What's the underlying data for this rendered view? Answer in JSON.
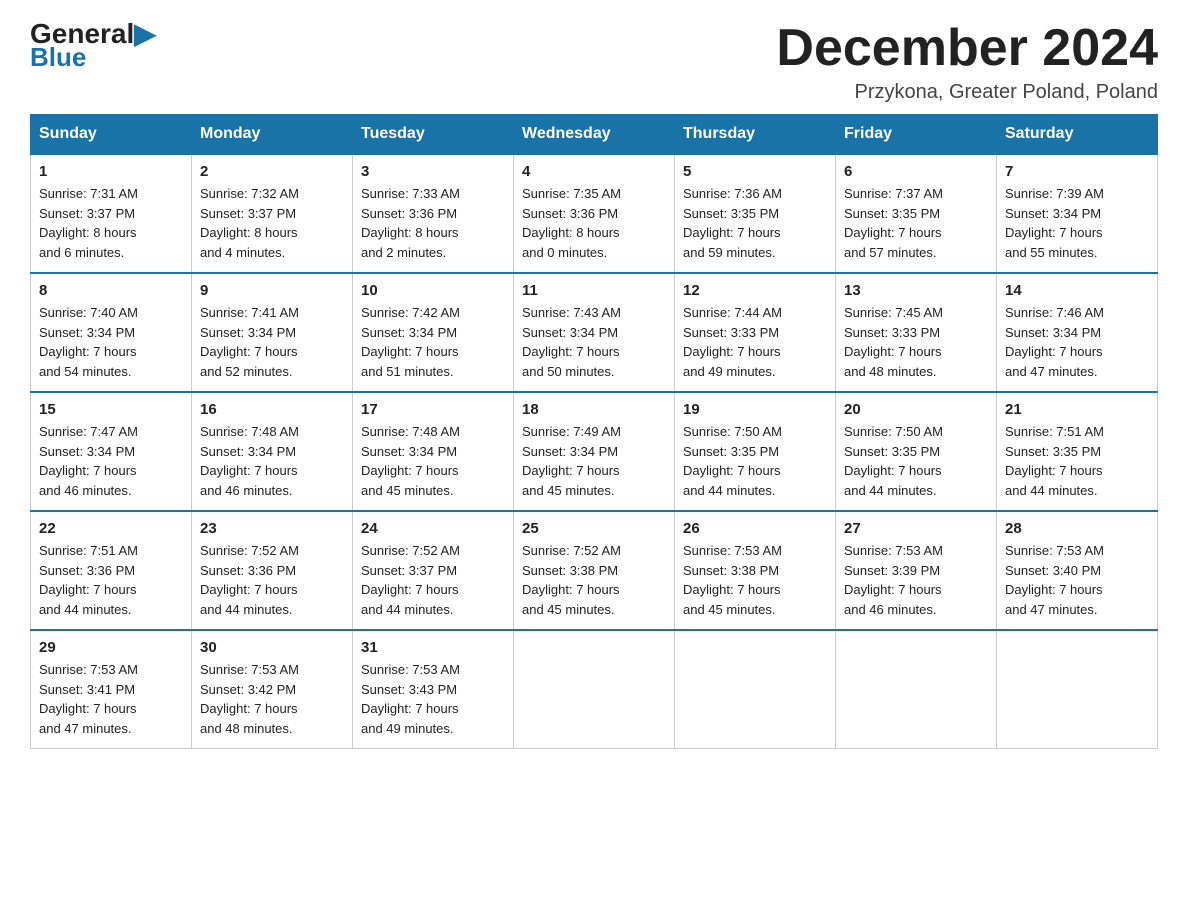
{
  "header": {
    "logo_general": "General",
    "logo_blue": "Blue",
    "title": "December 2024",
    "subtitle": "Przykona, Greater Poland, Poland"
  },
  "weekdays": [
    "Sunday",
    "Monday",
    "Tuesday",
    "Wednesday",
    "Thursday",
    "Friday",
    "Saturday"
  ],
  "weeks": [
    [
      {
        "day": "1",
        "sunrise": "7:31 AM",
        "sunset": "3:37 PM",
        "daylight": "8 hours and 6 minutes."
      },
      {
        "day": "2",
        "sunrise": "7:32 AM",
        "sunset": "3:37 PM",
        "daylight": "8 hours and 4 minutes."
      },
      {
        "day": "3",
        "sunrise": "7:33 AM",
        "sunset": "3:36 PM",
        "daylight": "8 hours and 2 minutes."
      },
      {
        "day": "4",
        "sunrise": "7:35 AM",
        "sunset": "3:36 PM",
        "daylight": "8 hours and 0 minutes."
      },
      {
        "day": "5",
        "sunrise": "7:36 AM",
        "sunset": "3:35 PM",
        "daylight": "7 hours and 59 minutes."
      },
      {
        "day": "6",
        "sunrise": "7:37 AM",
        "sunset": "3:35 PM",
        "daylight": "7 hours and 57 minutes."
      },
      {
        "day": "7",
        "sunrise": "7:39 AM",
        "sunset": "3:34 PM",
        "daylight": "7 hours and 55 minutes."
      }
    ],
    [
      {
        "day": "8",
        "sunrise": "7:40 AM",
        "sunset": "3:34 PM",
        "daylight": "7 hours and 54 minutes."
      },
      {
        "day": "9",
        "sunrise": "7:41 AM",
        "sunset": "3:34 PM",
        "daylight": "7 hours and 52 minutes."
      },
      {
        "day": "10",
        "sunrise": "7:42 AM",
        "sunset": "3:34 PM",
        "daylight": "7 hours and 51 minutes."
      },
      {
        "day": "11",
        "sunrise": "7:43 AM",
        "sunset": "3:34 PM",
        "daylight": "7 hours and 50 minutes."
      },
      {
        "day": "12",
        "sunrise": "7:44 AM",
        "sunset": "3:33 PM",
        "daylight": "7 hours and 49 minutes."
      },
      {
        "day": "13",
        "sunrise": "7:45 AM",
        "sunset": "3:33 PM",
        "daylight": "7 hours and 48 minutes."
      },
      {
        "day": "14",
        "sunrise": "7:46 AM",
        "sunset": "3:34 PM",
        "daylight": "7 hours and 47 minutes."
      }
    ],
    [
      {
        "day": "15",
        "sunrise": "7:47 AM",
        "sunset": "3:34 PM",
        "daylight": "7 hours and 46 minutes."
      },
      {
        "day": "16",
        "sunrise": "7:48 AM",
        "sunset": "3:34 PM",
        "daylight": "7 hours and 46 minutes."
      },
      {
        "day": "17",
        "sunrise": "7:48 AM",
        "sunset": "3:34 PM",
        "daylight": "7 hours and 45 minutes."
      },
      {
        "day": "18",
        "sunrise": "7:49 AM",
        "sunset": "3:34 PM",
        "daylight": "7 hours and 45 minutes."
      },
      {
        "day": "19",
        "sunrise": "7:50 AM",
        "sunset": "3:35 PM",
        "daylight": "7 hours and 44 minutes."
      },
      {
        "day": "20",
        "sunrise": "7:50 AM",
        "sunset": "3:35 PM",
        "daylight": "7 hours and 44 minutes."
      },
      {
        "day": "21",
        "sunrise": "7:51 AM",
        "sunset": "3:35 PM",
        "daylight": "7 hours and 44 minutes."
      }
    ],
    [
      {
        "day": "22",
        "sunrise": "7:51 AM",
        "sunset": "3:36 PM",
        "daylight": "7 hours and 44 minutes."
      },
      {
        "day": "23",
        "sunrise": "7:52 AM",
        "sunset": "3:36 PM",
        "daylight": "7 hours and 44 minutes."
      },
      {
        "day": "24",
        "sunrise": "7:52 AM",
        "sunset": "3:37 PM",
        "daylight": "7 hours and 44 minutes."
      },
      {
        "day": "25",
        "sunrise": "7:52 AM",
        "sunset": "3:38 PM",
        "daylight": "7 hours and 45 minutes."
      },
      {
        "day": "26",
        "sunrise": "7:53 AM",
        "sunset": "3:38 PM",
        "daylight": "7 hours and 45 minutes."
      },
      {
        "day": "27",
        "sunrise": "7:53 AM",
        "sunset": "3:39 PM",
        "daylight": "7 hours and 46 minutes."
      },
      {
        "day": "28",
        "sunrise": "7:53 AM",
        "sunset": "3:40 PM",
        "daylight": "7 hours and 47 minutes."
      }
    ],
    [
      {
        "day": "29",
        "sunrise": "7:53 AM",
        "sunset": "3:41 PM",
        "daylight": "7 hours and 47 minutes."
      },
      {
        "day": "30",
        "sunrise": "7:53 AM",
        "sunset": "3:42 PM",
        "daylight": "7 hours and 48 minutes."
      },
      {
        "day": "31",
        "sunrise": "7:53 AM",
        "sunset": "3:43 PM",
        "daylight": "7 hours and 49 minutes."
      },
      null,
      null,
      null,
      null
    ]
  ],
  "labels": {
    "sunrise": "Sunrise:",
    "sunset": "Sunset:",
    "daylight": "Daylight:"
  }
}
